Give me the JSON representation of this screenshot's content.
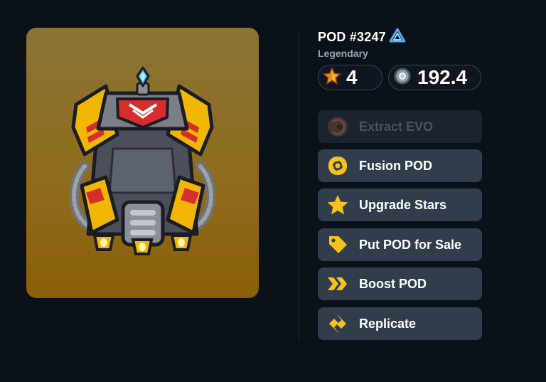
{
  "pod": {
    "title": "POD #3247",
    "rarity": "Legendary",
    "network_icon": "network-logo-icon",
    "art_icon": "yellow-robot-pod-art",
    "art_bg_top": "#8a7437",
    "art_bg_bottom": "#8a5f0a"
  },
  "stats": {
    "stars": "4",
    "stars_icon": "star-icon",
    "power": "192.4",
    "power_icon": "power-core-icon"
  },
  "actions": [
    {
      "label": "Extract EVO",
      "icon": "extract-icon",
      "enabled": false
    },
    {
      "label": "Fusion POD",
      "icon": "fusion-icon",
      "enabled": true
    },
    {
      "label": "Upgrade Stars",
      "icon": "star-icon",
      "enabled": true
    },
    {
      "label": "Put POD for Sale",
      "icon": "price-tag-icon",
      "enabled": true
    },
    {
      "label": "Boost POD",
      "icon": "boost-arrows-icon",
      "enabled": true
    },
    {
      "label": "Replicate",
      "icon": "replicate-icon",
      "enabled": true
    }
  ],
  "colors": {
    "background": "#0b1119",
    "button": "#323d4b",
    "button_disabled": "#1b232e",
    "accent_yellow": "#f7c21b",
    "muted_text": "#9aa4b0"
  }
}
